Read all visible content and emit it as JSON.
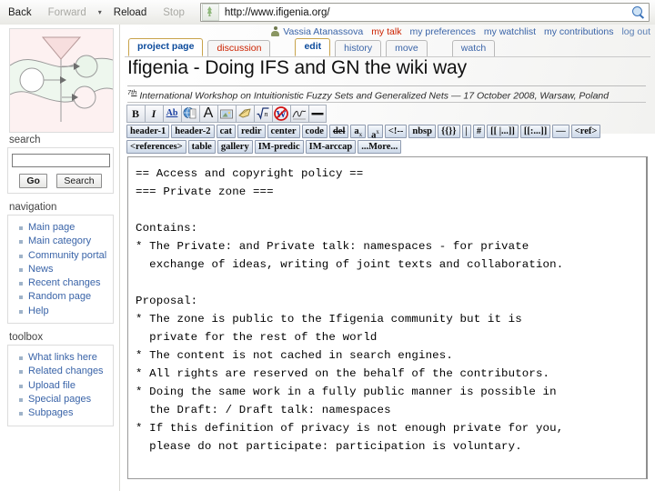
{
  "browser": {
    "back": "Back",
    "forward": "Forward",
    "reload": "Reload",
    "stop": "Stop",
    "url": "http://www.ifigenia.org/",
    "favicon_name": "site-favicon",
    "go_icon": "magnifier-icon"
  },
  "usertools": {
    "avatar_icon": "user-avatar-icon",
    "username": "Vassia Atanassova",
    "links": [
      {
        "label": "my talk",
        "style": "new"
      },
      {
        "label": "my preferences",
        "style": "normal"
      },
      {
        "label": "my watchlist",
        "style": "normal"
      },
      {
        "label": "my contributions",
        "style": "normal"
      },
      {
        "label": "log out",
        "style": "mute"
      }
    ]
  },
  "tabs": [
    {
      "label": "project page",
      "state": "selected"
    },
    {
      "label": "discussion",
      "state": "new"
    },
    {
      "label": "edit",
      "state": "selected",
      "gap": true
    },
    {
      "label": "history",
      "state": "normal"
    },
    {
      "label": "move",
      "state": "normal"
    },
    {
      "label": "watch",
      "state": "normal",
      "gap": true
    }
  ],
  "header": {
    "title": "Ifigenia - Doing IFS and GN the wiki way",
    "subtitle_sup": "7th",
    "subtitle": " International Workshop on Intuitionistic Fuzzy Sets and Generalized Nets — 17 October 2008, Warsaw, Poland"
  },
  "sidebar": {
    "logo_name": "ifigenia-generalized-net-logo",
    "search": {
      "heading": "search",
      "value": "",
      "placeholder": "",
      "go_label": "Go",
      "search_label": "Search"
    },
    "navigation": {
      "heading": "navigation",
      "items": [
        "Main page",
        "Main category",
        "Community portal",
        "News",
        "Recent changes",
        "Random page",
        "Help"
      ]
    },
    "toolbox": {
      "heading": "toolbox",
      "items": [
        "What links here",
        "Related changes",
        "Upload file",
        "Special pages",
        "Subpages"
      ]
    }
  },
  "toolbar": {
    "icon_row": [
      {
        "name": "bold-icon",
        "glyph": "B"
      },
      {
        "name": "italic-icon",
        "glyph": "I"
      },
      {
        "name": "internal-link-icon",
        "glyph": "Ab"
      },
      {
        "name": "external-link-icon",
        "glyph": "globe"
      },
      {
        "name": "headline-icon",
        "glyph": "A"
      },
      {
        "name": "embedded-image-icon",
        "glyph": "image"
      },
      {
        "name": "media-file-icon",
        "glyph": "horn"
      },
      {
        "name": "math-formula-icon",
        "glyph": "sqrt-n"
      },
      {
        "name": "nowiki-icon",
        "glyph": "W"
      },
      {
        "name": "signature-icon",
        "glyph": "signature"
      },
      {
        "name": "horizontal-line-icon",
        "glyph": "line"
      }
    ],
    "row2": [
      "header-1",
      "header-2",
      "cat",
      "redir",
      "center",
      "code",
      "del",
      "a x",
      "a x",
      "<!--",
      "nbsp",
      "{{}}",
      "|",
      "#",
      "[[ |...]]",
      "[[:...]]",
      "—",
      "<ref>"
    ],
    "row2_labels": {
      "header1": "header-1",
      "header2": "header-2",
      "cat": "cat",
      "redir": "redir",
      "center": "center",
      "code": "code",
      "del": "del",
      "sub": "a",
      "sub_x": "x",
      "sup": "a",
      "sup_x": "x",
      "comment": "<!--",
      "nbsp": "nbsp",
      "braces": "{{}}",
      "pipe": "|",
      "hash": "#",
      "pipedlink": "[[ |...]]",
      "colonlink": "[[:...]]",
      "mdash": "—",
      "ref": "<ref>"
    },
    "row3": [
      "<references>",
      "table",
      "gallery",
      "IM-predic",
      "IM-arccap",
      "...More..."
    ]
  },
  "editor": {
    "name": "wikitext-editor",
    "content": "== Access and copyright policy ==\n=== Private zone ===\n\nContains:\n* The Private: and Private talk: namespaces - for private\n  exchange of ideas, writing of joint texts and collaboration.\n\nProposal:\n* The zone is public to the Ifigenia community but it is\n  private for the rest of the world\n* The content is not cached in search engines.\n* All rights are reserved on the behalf of the contributors.\n* Doing the same work in a fully public manner is possible in\n  the Draft: / Draft talk: namespaces\n* If this definition of privacy is not enough private for you,\n  please do not participate: participation is voluntary."
  },
  "colors": {
    "link": "#3a64a8",
    "newlink": "#cc2200",
    "tab_active_border": "#c8a34b",
    "toolbar_button": "#ccd8e8"
  }
}
